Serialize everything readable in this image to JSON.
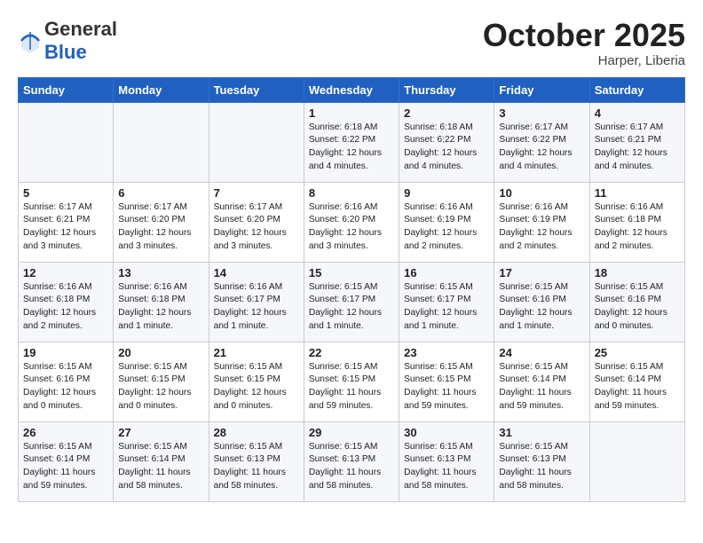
{
  "header": {
    "logo_general": "General",
    "logo_blue": "Blue",
    "month_title": "October 2025",
    "location": "Harper, Liberia"
  },
  "weekdays": [
    "Sunday",
    "Monday",
    "Tuesday",
    "Wednesday",
    "Thursday",
    "Friday",
    "Saturday"
  ],
  "weeks": [
    [
      {
        "day": "",
        "info": ""
      },
      {
        "day": "",
        "info": ""
      },
      {
        "day": "",
        "info": ""
      },
      {
        "day": "1",
        "info": "Sunrise: 6:18 AM\nSunset: 6:22 PM\nDaylight: 12 hours\nand 4 minutes."
      },
      {
        "day": "2",
        "info": "Sunrise: 6:18 AM\nSunset: 6:22 PM\nDaylight: 12 hours\nand 4 minutes."
      },
      {
        "day": "3",
        "info": "Sunrise: 6:17 AM\nSunset: 6:22 PM\nDaylight: 12 hours\nand 4 minutes."
      },
      {
        "day": "4",
        "info": "Sunrise: 6:17 AM\nSunset: 6:21 PM\nDaylight: 12 hours\nand 4 minutes."
      }
    ],
    [
      {
        "day": "5",
        "info": "Sunrise: 6:17 AM\nSunset: 6:21 PM\nDaylight: 12 hours\nand 3 minutes."
      },
      {
        "day": "6",
        "info": "Sunrise: 6:17 AM\nSunset: 6:20 PM\nDaylight: 12 hours\nand 3 minutes."
      },
      {
        "day": "7",
        "info": "Sunrise: 6:17 AM\nSunset: 6:20 PM\nDaylight: 12 hours\nand 3 minutes."
      },
      {
        "day": "8",
        "info": "Sunrise: 6:16 AM\nSunset: 6:20 PM\nDaylight: 12 hours\nand 3 minutes."
      },
      {
        "day": "9",
        "info": "Sunrise: 6:16 AM\nSunset: 6:19 PM\nDaylight: 12 hours\nand 2 minutes."
      },
      {
        "day": "10",
        "info": "Sunrise: 6:16 AM\nSunset: 6:19 PM\nDaylight: 12 hours\nand 2 minutes."
      },
      {
        "day": "11",
        "info": "Sunrise: 6:16 AM\nSunset: 6:18 PM\nDaylight: 12 hours\nand 2 minutes."
      }
    ],
    [
      {
        "day": "12",
        "info": "Sunrise: 6:16 AM\nSunset: 6:18 PM\nDaylight: 12 hours\nand 2 minutes."
      },
      {
        "day": "13",
        "info": "Sunrise: 6:16 AM\nSunset: 6:18 PM\nDaylight: 12 hours\nand 1 minute."
      },
      {
        "day": "14",
        "info": "Sunrise: 6:16 AM\nSunset: 6:17 PM\nDaylight: 12 hours\nand 1 minute."
      },
      {
        "day": "15",
        "info": "Sunrise: 6:15 AM\nSunset: 6:17 PM\nDaylight: 12 hours\nand 1 minute."
      },
      {
        "day": "16",
        "info": "Sunrise: 6:15 AM\nSunset: 6:17 PM\nDaylight: 12 hours\nand 1 minute."
      },
      {
        "day": "17",
        "info": "Sunrise: 6:15 AM\nSunset: 6:16 PM\nDaylight: 12 hours\nand 1 minute."
      },
      {
        "day": "18",
        "info": "Sunrise: 6:15 AM\nSunset: 6:16 PM\nDaylight: 12 hours\nand 0 minutes."
      }
    ],
    [
      {
        "day": "19",
        "info": "Sunrise: 6:15 AM\nSunset: 6:16 PM\nDaylight: 12 hours\nand 0 minutes."
      },
      {
        "day": "20",
        "info": "Sunrise: 6:15 AM\nSunset: 6:15 PM\nDaylight: 12 hours\nand 0 minutes."
      },
      {
        "day": "21",
        "info": "Sunrise: 6:15 AM\nSunset: 6:15 PM\nDaylight: 12 hours\nand 0 minutes."
      },
      {
        "day": "22",
        "info": "Sunrise: 6:15 AM\nSunset: 6:15 PM\nDaylight: 11 hours\nand 59 minutes."
      },
      {
        "day": "23",
        "info": "Sunrise: 6:15 AM\nSunset: 6:15 PM\nDaylight: 11 hours\nand 59 minutes."
      },
      {
        "day": "24",
        "info": "Sunrise: 6:15 AM\nSunset: 6:14 PM\nDaylight: 11 hours\nand 59 minutes."
      },
      {
        "day": "25",
        "info": "Sunrise: 6:15 AM\nSunset: 6:14 PM\nDaylight: 11 hours\nand 59 minutes."
      }
    ],
    [
      {
        "day": "26",
        "info": "Sunrise: 6:15 AM\nSunset: 6:14 PM\nDaylight: 11 hours\nand 59 minutes."
      },
      {
        "day": "27",
        "info": "Sunrise: 6:15 AM\nSunset: 6:14 PM\nDaylight: 11 hours\nand 58 minutes."
      },
      {
        "day": "28",
        "info": "Sunrise: 6:15 AM\nSunset: 6:13 PM\nDaylight: 11 hours\nand 58 minutes."
      },
      {
        "day": "29",
        "info": "Sunrise: 6:15 AM\nSunset: 6:13 PM\nDaylight: 11 hours\nand 58 minutes."
      },
      {
        "day": "30",
        "info": "Sunrise: 6:15 AM\nSunset: 6:13 PM\nDaylight: 11 hours\nand 58 minutes."
      },
      {
        "day": "31",
        "info": "Sunrise: 6:15 AM\nSunset: 6:13 PM\nDaylight: 11 hours\nand 58 minutes."
      },
      {
        "day": "",
        "info": ""
      }
    ]
  ]
}
